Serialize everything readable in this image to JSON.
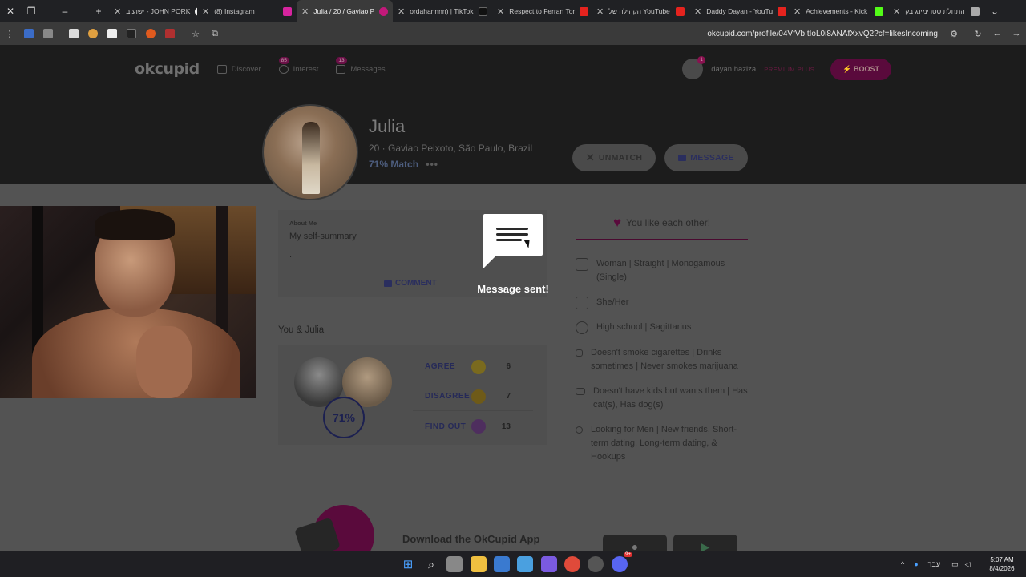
{
  "browser": {
    "tabs": [
      {
        "title": "ישוע ב - JOHN PORK",
        "color": "#f0f0f0",
        "active": false
      },
      {
        "title": "(8) Instagram",
        "color": "#d6249f",
        "active": false
      },
      {
        "title": "Julia / 20 / Gaviao Pe",
        "color": "#c2197a",
        "active": true
      },
      {
        "title": "ordahannnn) | TikTok",
        "color": "#111111",
        "active": false
      },
      {
        "title": "Respect to Ferran Tor",
        "color": "#e5231e",
        "active": false
      },
      {
        "title": "הקהילה של YouTube",
        "color": "#e5231e",
        "active": false
      },
      {
        "title": "Daddy Dayan - YouTu",
        "color": "#e5231e",
        "active": false
      },
      {
        "title": "Achievements - Kick",
        "color": "#53fc18",
        "active": false
      },
      {
        "title": "התחלת סטרימינג בק",
        "color": "#aaaaaa",
        "active": false
      }
    ],
    "url": "okcupid.com/profile/04VfVbItIoL0i8ANAfXxvQ2?cf=likesIncoming"
  },
  "site": {
    "logo": "okcupid",
    "nav": {
      "discover": "Discover",
      "interest": "Interest",
      "interest_badge": "85",
      "messages": "Messages",
      "messages_badge": "13"
    },
    "user_name": "dayan haziza",
    "user_badge": "1",
    "premium_label": "PREMIUM PLUS",
    "boost_label": "⚡ BOOST"
  },
  "profile": {
    "name": "Julia",
    "age_location": "20  ·  Gaviao Peixoto, São Paulo, Brazil",
    "match": "71% Match",
    "match_menu": "•••",
    "unmatch_label": "UNMATCH",
    "message_label": "MESSAGE"
  },
  "about": {
    "label": "About Me",
    "title": "My self-summary",
    "text": ".",
    "comment_label": "COMMENT"
  },
  "compat": {
    "heading": "You & Julia",
    "percent": "71%",
    "rows": [
      {
        "label": "AGREE",
        "count": "6",
        "emoji_color": "#7a6a1e"
      },
      {
        "label": "DISAGREE",
        "count": "7",
        "emoji_color": "#6e5a18"
      },
      {
        "label": "FIND OUT",
        "count": "13",
        "emoji_color": "#4e2e5e"
      }
    ]
  },
  "details": {
    "like_each_other": "You like each other!",
    "items": [
      {
        "text": "Woman | Straight | Monogamous (Single)",
        "icon": "gender-icon"
      },
      {
        "text": "She/Her",
        "icon": "pronoun-icon"
      },
      {
        "text": "High school | Sagittarius",
        "icon": "globe-icon"
      },
      {
        "text": "Doesn't smoke cigarettes | Drinks sometimes | Never smokes marijuana",
        "icon": "drink-icon"
      },
      {
        "text": "Doesn't have kids but wants them | Has cat(s), Has dog(s)",
        "icon": "family-icon"
      },
      {
        "text": "Looking for Men | New friends, Short-term dating, Long-term dating, & Hookups",
        "icon": "search-icon"
      }
    ]
  },
  "download": {
    "title": "Download the OkCupid App"
  },
  "toast": {
    "text": "Message sent!"
  },
  "taskbar": {
    "language": "עבר",
    "time": "5:07 AM",
    "date": "8/4/2026",
    "discord_badge": "9+"
  }
}
